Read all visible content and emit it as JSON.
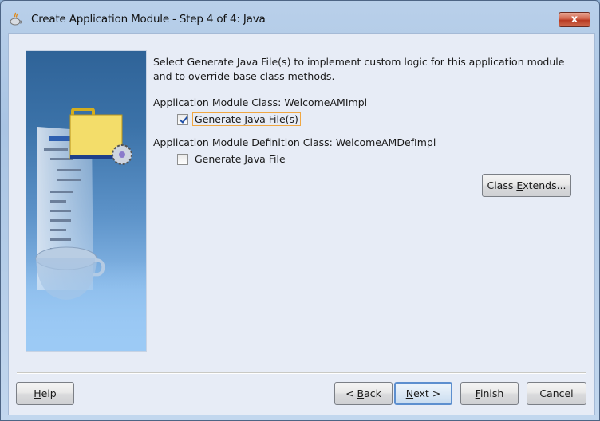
{
  "window": {
    "title": "Create Application Module - Step 4 of 4: Java",
    "app_icon": "java-cup-icon",
    "close_label": "x"
  },
  "main": {
    "description": "Select Generate Java File(s) to implement custom logic for this application module and to override base class methods.",
    "am_class_label": "Application Module Class: WelcomeAMImpl",
    "am_generate": {
      "pre": "",
      "key": "G",
      "post": "enerate Java File(s)",
      "checked": true
    },
    "am_def_class_label": "Application Module Definition Class: WelcomeAMDefImpl",
    "am_def_generate": {
      "pre": "Generate ",
      "key": "J",
      "post": "ava File",
      "checked": false
    },
    "class_extends": {
      "pre": "Class ",
      "key": "E",
      "post": "xtends..."
    }
  },
  "footer": {
    "help": {
      "pre": "",
      "key": "H",
      "post": "elp"
    },
    "back": {
      "pre": "< ",
      "key": "B",
      "post": "ack"
    },
    "next": {
      "pre": "",
      "key": "N",
      "post": "ext >"
    },
    "finish": {
      "pre": "",
      "key": "F",
      "post": "inish"
    },
    "cancel": {
      "pre": "Cancel",
      "key": "",
      "post": ""
    }
  },
  "colors": {
    "accent_focus": "#f0a742",
    "default_button_border": "#5d8fcf"
  }
}
